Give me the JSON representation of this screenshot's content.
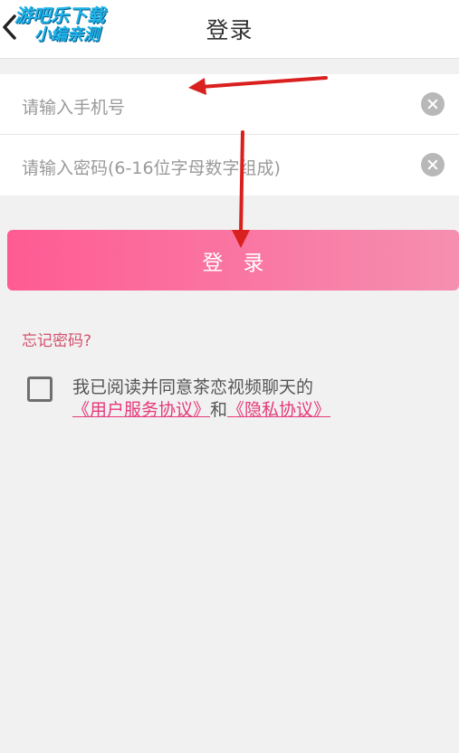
{
  "header": {
    "title": "登录",
    "back_icon": "chevron-left-icon",
    "watermark_line1": "游吧乐下载",
    "watermark_line2": "小编亲测"
  },
  "form": {
    "phone_placeholder": "请输入手机号",
    "password_placeholder": "请输入密码(6-16位字母数字组成)",
    "clear_icon": "clear-circle-icon"
  },
  "login_button_label": "登录",
  "forgot_password": "忘记密码?",
  "agreement": {
    "checked": false,
    "prefix": "我已阅读并同意茶恋视频聊天的",
    "user_agreement": "《用户服务协议》",
    "and": "和",
    "privacy_policy": "《隐私协议》"
  },
  "colors": {
    "accent_start": "#ff5b93",
    "accent_end": "#f58fb0",
    "link": "#e6387a",
    "forgot": "#d4516e",
    "annotation_arrow": "#d9201f",
    "background": "#f1f1f1"
  }
}
